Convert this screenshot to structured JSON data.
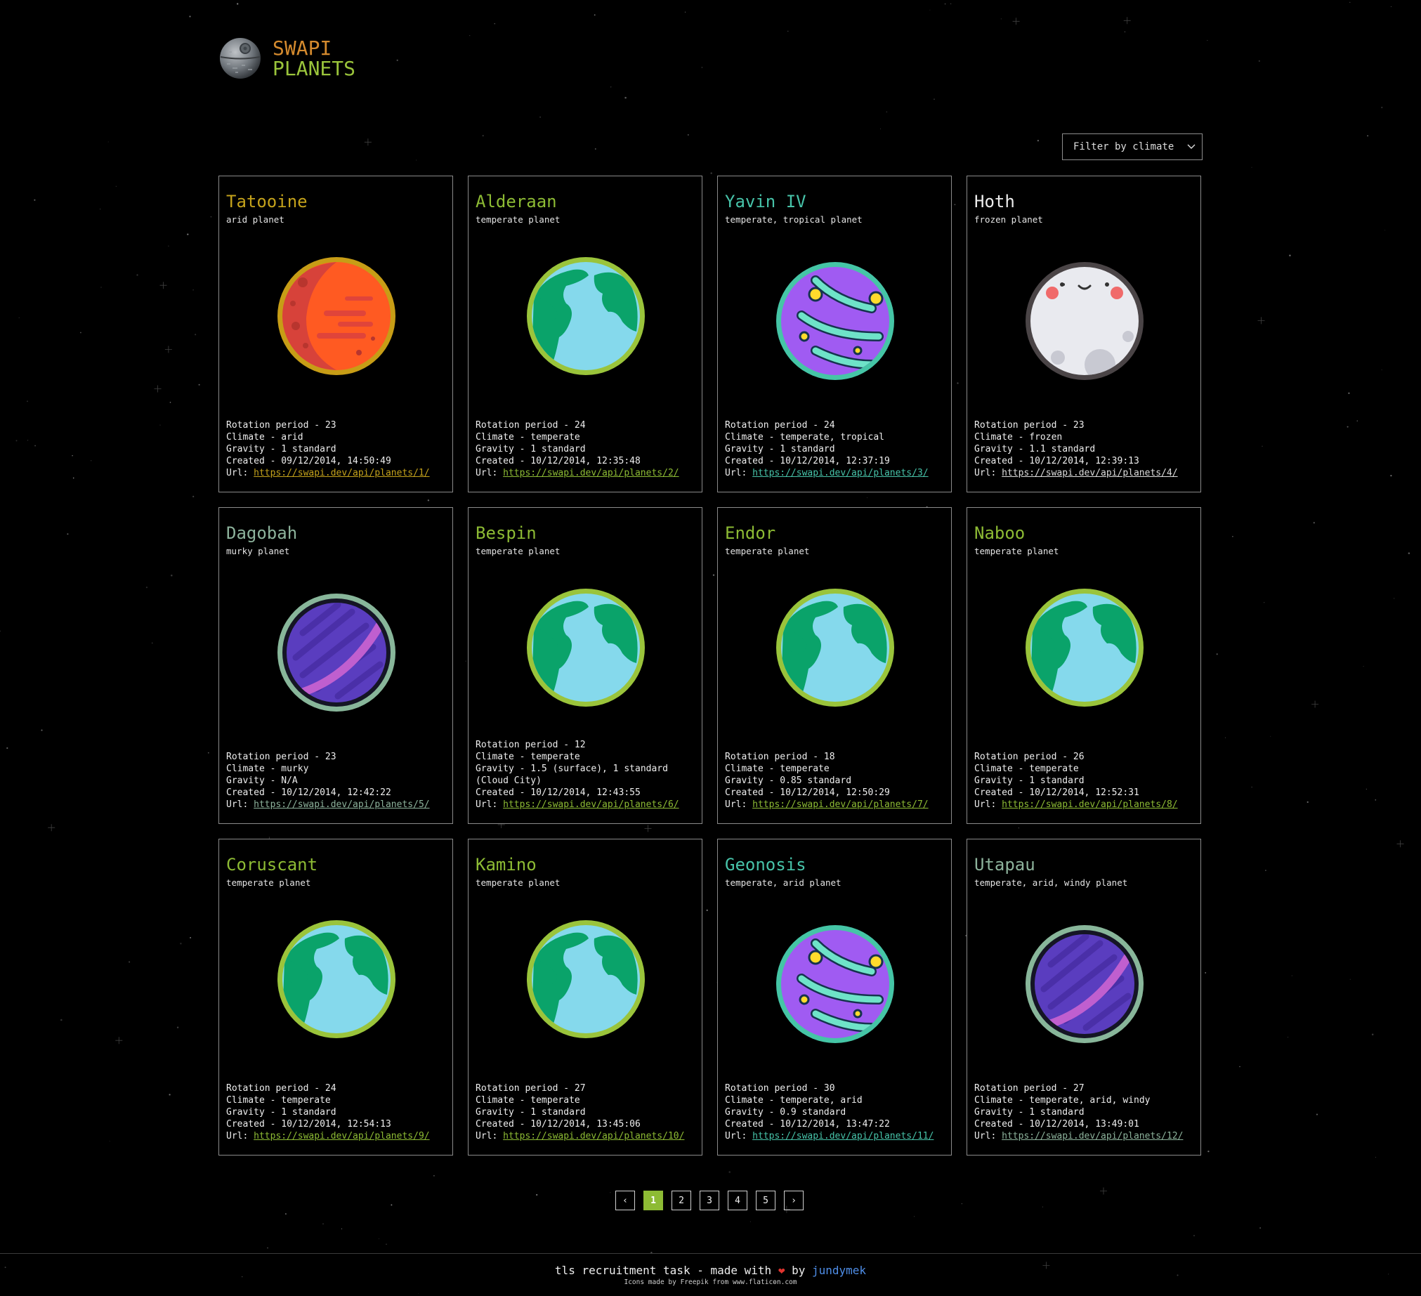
{
  "app": {
    "logo_word1": "SWAPI",
    "logo_word2": "PLANETS",
    "filter_label": "Filter by climate"
  },
  "colors": {
    "arid": "#c4a21b",
    "temperate": "#8dbb34",
    "tropical": "#47c3a9",
    "frozen": "#ececec",
    "murky": "#8db39c",
    "accent": "#8dbb34"
  },
  "labels": {
    "rotation": "Rotation period - ",
    "climate": "Climate - ",
    "gravity": "Gravity - ",
    "created": "Created - ",
    "url": "Url: "
  },
  "planets": [
    {
      "name": "Tatooine",
      "subtitle": "arid planet",
      "rotation": "23",
      "climate": "arid",
      "gravity": "1 standard",
      "created": "09/12/2014, 14:50:49",
      "url": "https://swapi.dev/api/planets/1/",
      "icon": "mars-icon",
      "color": "#c4a21b"
    },
    {
      "name": "Alderaan",
      "subtitle": "temperate planet",
      "rotation": "24",
      "climate": "temperate",
      "gravity": "1 standard",
      "created": "10/12/2014, 12:35:48",
      "url": "https://swapi.dev/api/planets/2/",
      "icon": "earth-icon",
      "color": "#8dbb34"
    },
    {
      "name": "Yavin IV",
      "subtitle": "temperate, tropical planet",
      "rotation": "24",
      "climate": "temperate, tropical",
      "gravity": "1 standard",
      "created": "10/12/2014, 12:37:19",
      "url": "https://swapi.dev/api/planets/3/",
      "icon": "jungle-planet-icon",
      "color": "#47c3a9"
    },
    {
      "name": "Hoth",
      "subtitle": "frozen planet",
      "rotation": "23",
      "climate": "frozen",
      "gravity": "1.1 standard",
      "created": "10/12/2014, 12:39:13",
      "url": "https://swapi.dev/api/planets/4/",
      "icon": "moon-face-icon",
      "color": "#ececec"
    },
    {
      "name": "Dagobah",
      "subtitle": "murky planet",
      "rotation": "23",
      "climate": "murky",
      "gravity": "N/A",
      "created": "10/12/2014, 12:42:22",
      "url": "https://swapi.dev/api/planets/5/",
      "icon": "ringed-planet-icon",
      "color": "#8db39c"
    },
    {
      "name": "Bespin",
      "subtitle": "temperate planet",
      "rotation": "12",
      "climate": "temperate",
      "gravity": "1.5 (surface), 1 standard (Cloud City)",
      "created": "10/12/2014, 12:43:55",
      "url": "https://swapi.dev/api/planets/6/",
      "icon": "earth-icon",
      "color": "#8dbb34"
    },
    {
      "name": "Endor",
      "subtitle": "temperate planet",
      "rotation": "18",
      "climate": "temperate",
      "gravity": "0.85 standard",
      "created": "10/12/2014, 12:50:29",
      "url": "https://swapi.dev/api/planets/7/",
      "icon": "earth-icon",
      "color": "#8dbb34"
    },
    {
      "name": "Naboo",
      "subtitle": "temperate planet",
      "rotation": "26",
      "climate": "temperate",
      "gravity": "1 standard",
      "created": "10/12/2014, 12:52:31",
      "url": "https://swapi.dev/api/planets/8/",
      "icon": "earth-icon",
      "color": "#8dbb34"
    },
    {
      "name": "Coruscant",
      "subtitle": "temperate planet",
      "rotation": "24",
      "climate": "temperate",
      "gravity": "1 standard",
      "created": "10/12/2014, 12:54:13",
      "url": "https://swapi.dev/api/planets/9/",
      "icon": "earth-icon",
      "color": "#8dbb34"
    },
    {
      "name": "Kamino",
      "subtitle": "temperate planet",
      "rotation": "27",
      "climate": "temperate",
      "gravity": "1 standard",
      "created": "10/12/2014, 13:45:06",
      "url": "https://swapi.dev/api/planets/10/",
      "icon": "earth-icon",
      "color": "#8dbb34"
    },
    {
      "name": "Geonosis",
      "subtitle": "temperate, arid planet",
      "rotation": "30",
      "climate": "temperate, arid",
      "gravity": "0.9 standard",
      "created": "10/12/2014, 13:47:22",
      "url": "https://swapi.dev/api/planets/11/",
      "icon": "jungle-planet-icon",
      "color": "#47c3a9"
    },
    {
      "name": "Utapau",
      "subtitle": "temperate, arid, windy planet",
      "rotation": "27",
      "climate": "temperate, arid, windy",
      "gravity": "1 standard",
      "created": "10/12/2014, 13:49:01",
      "url": "https://swapi.dev/api/planets/12/",
      "icon": "ringed-planet-icon",
      "color": "#8db39c"
    }
  ],
  "pagination": {
    "prev": "‹",
    "next": "›",
    "pages": [
      "1",
      "2",
      "3",
      "4",
      "5"
    ],
    "current": "1"
  },
  "footer": {
    "text_before": "tls recruitment task - made with",
    "heart": "❤",
    "by": "by",
    "author": "jundymek",
    "credit_icons_made_by": "Icons made by",
    "credit_author": "Freepik",
    "credit_from": "from",
    "credit_site": "www.flaticon.com"
  }
}
